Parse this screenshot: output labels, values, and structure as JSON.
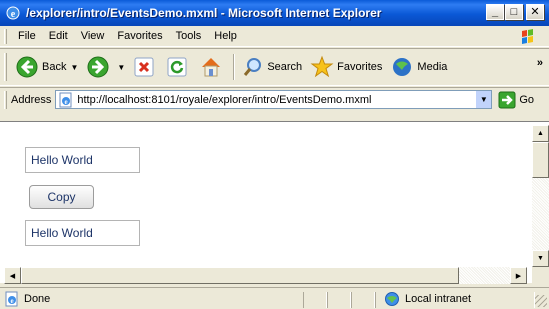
{
  "window": {
    "title": "/explorer/intro/EventsDemo.mxml - Microsoft Internet Explorer",
    "minimize": "_",
    "maximize": "□",
    "close": "✕"
  },
  "menu": {
    "items": [
      "File",
      "Edit",
      "View",
      "Favorites",
      "Tools",
      "Help"
    ]
  },
  "toolbar": {
    "back_label": "Back",
    "search_label": "Search",
    "favorites_label": "Favorites",
    "media_label": "Media",
    "overflow": "»"
  },
  "address": {
    "label": "Address",
    "url": "http://localhost:8101/royale/explorer/intro/EventsDemo.mxml",
    "go_label": "Go"
  },
  "page": {
    "input_top_value": "Hello World",
    "copy_button_label": "Copy",
    "input_bottom_value": "Hello World"
  },
  "status": {
    "text": "Done",
    "zone": "Local intranet"
  },
  "colors": {
    "title_bar": "#0a58d6",
    "chrome": "#ece9d8",
    "field_text": "#1d3468"
  },
  "icons": [
    "ie-icon",
    "ms-flag-icon",
    "back-icon",
    "forward-icon",
    "stop-icon",
    "refresh-icon",
    "home-icon",
    "search-icon",
    "favorites-star-icon",
    "media-icon",
    "page-icon",
    "go-arrow-icon",
    "done-page-icon",
    "intranet-icon"
  ]
}
